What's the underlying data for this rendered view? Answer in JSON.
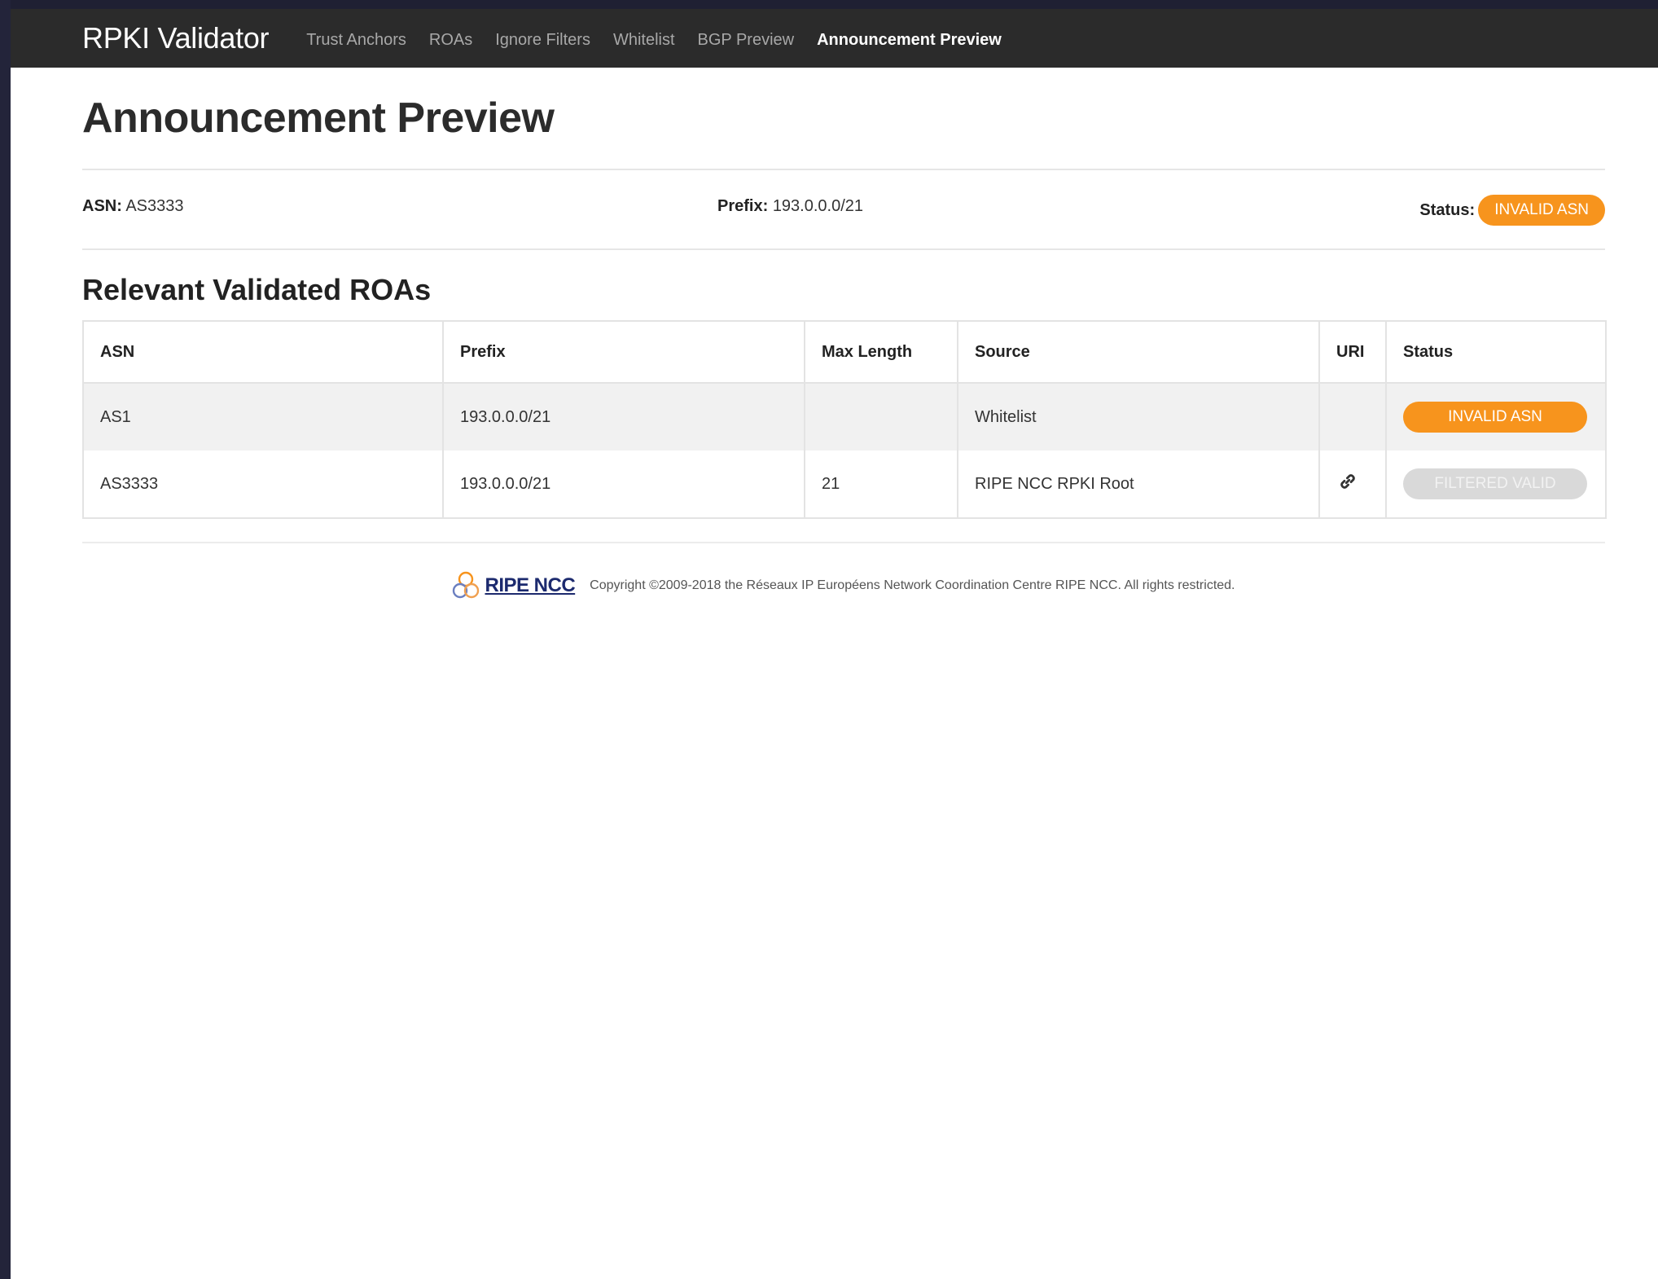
{
  "navbar": {
    "brand": "RPKI Validator",
    "links": [
      {
        "label": "Trust Anchors",
        "active": false
      },
      {
        "label": "ROAs",
        "active": false
      },
      {
        "label": "Ignore Filters",
        "active": false
      },
      {
        "label": "Whitelist",
        "active": false
      },
      {
        "label": "BGP Preview",
        "active": false
      },
      {
        "label": "Announcement Preview",
        "active": true
      }
    ]
  },
  "page": {
    "title": "Announcement Preview"
  },
  "summary": {
    "asn_label": "ASN:",
    "asn_value": "AS3333",
    "prefix_label": "Prefix:",
    "prefix_value": "193.0.0.0/21",
    "status_label": "Status:",
    "status_value": "INVALID ASN"
  },
  "roas": {
    "title": "Relevant Validated ROAs",
    "columns": [
      "ASN",
      "Prefix",
      "Max Length",
      "Source",
      "URI",
      "Status"
    ],
    "rows": [
      {
        "asn": "AS1",
        "prefix": "193.0.0.0/21",
        "max_length": "",
        "source": "Whitelist",
        "uri": "",
        "status": "INVALID ASN"
      },
      {
        "asn": "AS3333",
        "prefix": "193.0.0.0/21",
        "max_length": "21",
        "source": "RIPE NCC RPKI Root",
        "uri": "link-icon",
        "status": "FILTERED VALID"
      }
    ]
  },
  "footer": {
    "logo_text": "RIPE NCC",
    "copyright": "Copyright ©2009-2018 the Réseaux IP Européens Network Coordination Centre RIPE NCC. All rights restricted."
  },
  "colors": {
    "navbar": "#2b2b2b",
    "invalid": "#f7941d",
    "filtered": "#d9d9d9",
    "logo": "#1c2a6e"
  }
}
